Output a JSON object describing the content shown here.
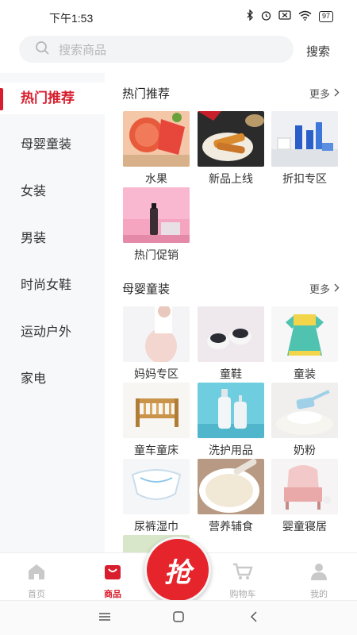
{
  "status": {
    "time": "下午1:53",
    "battery": "97"
  },
  "search": {
    "placeholder": "搜索商品",
    "button": "搜索"
  },
  "sidebar": {
    "items": [
      {
        "label": "热门推荐",
        "active": true
      },
      {
        "label": "母婴童装"
      },
      {
        "label": "女装"
      },
      {
        "label": "男装"
      },
      {
        "label": "时尚女鞋"
      },
      {
        "label": "运动户外"
      },
      {
        "label": "家电"
      }
    ]
  },
  "sections": [
    {
      "title": "热门推荐",
      "more": "更多",
      "tiles": [
        "水果",
        "新品上线",
        "折扣专区",
        "热门促销"
      ]
    },
    {
      "title": "母婴童装",
      "more": "更多",
      "tiles": [
        "妈妈专区",
        "童鞋",
        "童装",
        "童车童床",
        "洗护用品",
        "奶粉",
        "尿裤湿巾",
        "营养辅食",
        "婴童寝居"
      ]
    }
  ],
  "nav": {
    "home": "首页",
    "goods": "商品",
    "grab": "抢",
    "cart": "购物车",
    "mine": "我的"
  },
  "colors": {
    "accent": "#d81e2e",
    "sidebar_bg": "#f7f8fa"
  }
}
